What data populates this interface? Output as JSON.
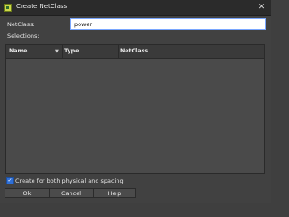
{
  "window": {
    "title": "Create NetClass",
    "close_glyph": "✕"
  },
  "form": {
    "netclass_label": "NetClass:",
    "netclass_value": "power",
    "selections_label": "Selections:"
  },
  "grid": {
    "columns": [
      "Name",
      "Type",
      "NetClass"
    ],
    "sort_indicator": "▼",
    "rows": []
  },
  "options": {
    "both_physical_spacing_label": "Create  for both physical and spacing",
    "both_physical_spacing_checked": true,
    "check_glyph": "✓"
  },
  "buttons": {
    "ok": "Ok",
    "cancel": "Cancel",
    "help": "Help"
  }
}
